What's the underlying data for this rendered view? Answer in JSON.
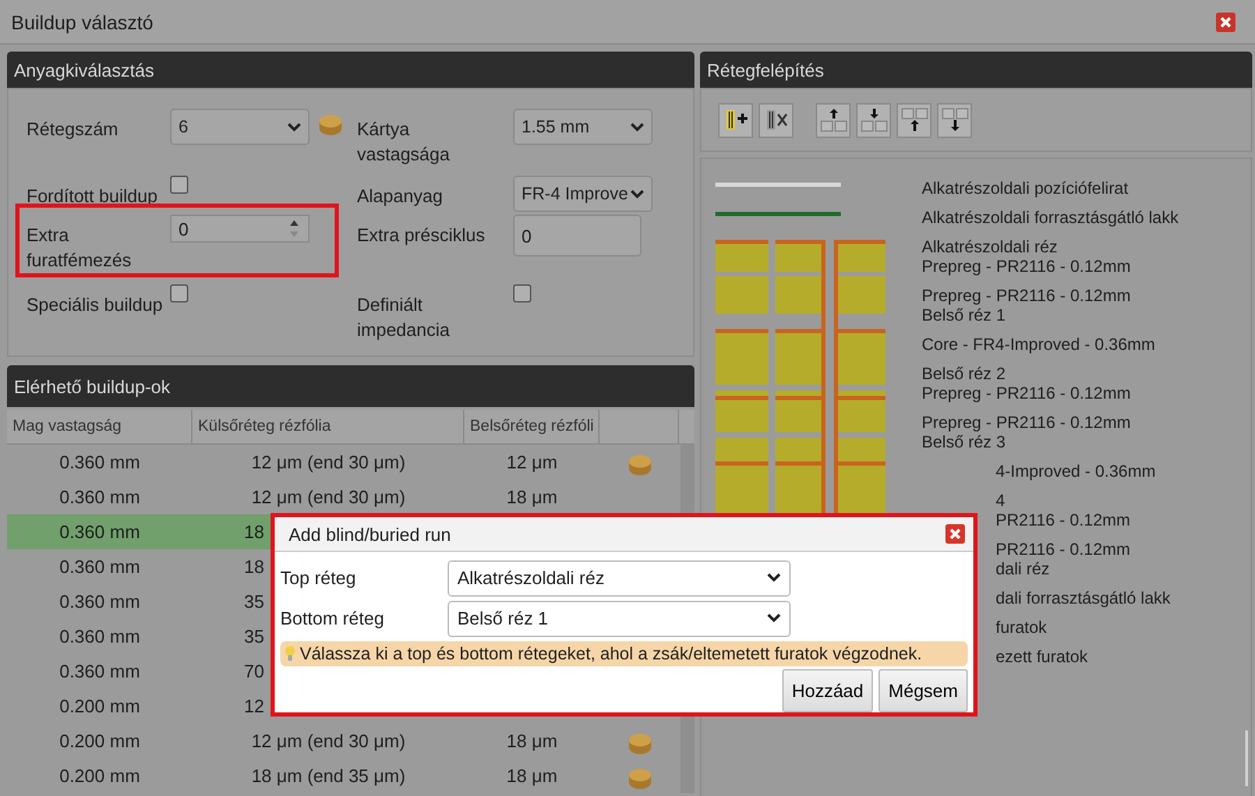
{
  "window": {
    "title": "Buildup választó"
  },
  "material_panel": {
    "title": "Anyagkiválasztás"
  },
  "form": {
    "fields": [
      {
        "label": "Rétegszám",
        "kind": "select",
        "value": "6",
        "coin": true,
        "highlighted": false
      },
      {
        "label": "Kártya vastagsága",
        "kind": "select",
        "value": "1.55 mm",
        "coin": false,
        "highlighted": false
      },
      {
        "label": "Fordított buildup",
        "kind": "checkbox",
        "checked": false,
        "coin": false,
        "highlighted": false
      },
      {
        "label": "Alapanyag",
        "kind": "select",
        "value": "FR-4 Improve",
        "coin": false,
        "highlighted": false
      },
      {
        "label": "Extra furatfémezés",
        "kind": "spinner",
        "value": "0",
        "coin": false,
        "highlighted": true
      },
      {
        "label": "Extra présciklus",
        "kind": "input",
        "value": "0",
        "coin": false,
        "highlighted": false
      },
      {
        "label": "Speciális buildup",
        "kind": "checkbox",
        "checked": false,
        "coin": false,
        "highlighted": false
      },
      {
        "label": "Definiált impedancia",
        "kind": "checkbox",
        "checked": false,
        "coin": false,
        "highlighted": false
      }
    ]
  },
  "table": {
    "title": "Elérhető buildup-ok",
    "columns": [
      "Mag vastagság",
      "Külsőréteg rézfólia",
      "Belsőréteg rézfóli"
    ],
    "rows": [
      {
        "cells": [
          "0.360 mm",
          "12 μm (end 30 μm)",
          "12 μm"
        ],
        "coin": true,
        "covered": false,
        "selected": false
      },
      {
        "cells": [
          "0.360 mm",
          "12 μm (end 30 μm)",
          "18 μm"
        ],
        "coin": false,
        "covered": false,
        "selected": false
      },
      {
        "cells": [
          "0.360 mm",
          "18"
        ],
        "coin": false,
        "covered": true,
        "selected": true
      },
      {
        "cells": [
          "0.360 mm",
          "18"
        ],
        "coin": false,
        "covered": true,
        "selected": false
      },
      {
        "cells": [
          "0.360 mm",
          "35"
        ],
        "coin": false,
        "covered": true,
        "selected": false
      },
      {
        "cells": [
          "0.360 mm",
          "35"
        ],
        "coin": false,
        "covered": true,
        "selected": false
      },
      {
        "cells": [
          "0.360 mm",
          "70"
        ],
        "coin": false,
        "covered": true,
        "selected": false
      },
      {
        "cells": [
          "0.200 mm",
          "12"
        ],
        "coin": false,
        "covered": true,
        "selected": false
      },
      {
        "cells": [
          "0.200 mm",
          "12 μm (end 30 μm)",
          "18 μm"
        ],
        "coin": true,
        "covered": false,
        "selected": false
      },
      {
        "cells": [
          "0.200 mm",
          "18 μm (end 35 μm)",
          "18 μm"
        ],
        "coin": true,
        "covered": false,
        "selected": false
      }
    ]
  },
  "stackup": {
    "title": "Rétegfelépítés",
    "blocks": [
      [
        "Alkatrészoldali pozíciófelirat"
      ],
      [
        "Alkatrészoldali forrasztásgátló lakk"
      ],
      [
        "Alkatrészoldali réz",
        "Prepreg - PR2116 - 0.12mm"
      ],
      [
        "Prepreg - PR2116 - 0.12mm",
        "Belső réz 1"
      ],
      [
        "Core - FR4-Improved - 0.36mm"
      ],
      [
        "Belső réz 2",
        "Prepreg - PR2116 - 0.12mm"
      ],
      [
        "Prepreg - PR2116 - 0.12mm",
        "Belső réz 3"
      ]
    ],
    "partly_covered_blocks": [
      [
        "4-Improved - 0.36mm"
      ],
      [
        "4",
        "PR2116 - 0.12mm"
      ],
      [
        "PR2116 - 0.12mm",
        "dali réz"
      ],
      [
        "dali forrasztásgátló lakk"
      ],
      [
        "furatok"
      ],
      [
        "ezett furatok"
      ]
    ]
  },
  "dialog": {
    "title": "Add blind/buried run",
    "fields": [
      {
        "label": "Top réteg",
        "value": "Alkatrészoldali réz"
      },
      {
        "label": "Bottom réteg",
        "value": "Belső réz 1"
      }
    ],
    "hint": "Válassza ki a top és bottom rétegeket, ahol a zsák/eltemetett furatok végzodnek.",
    "buttons": [
      "Hozzáad",
      "Mégsem"
    ]
  }
}
